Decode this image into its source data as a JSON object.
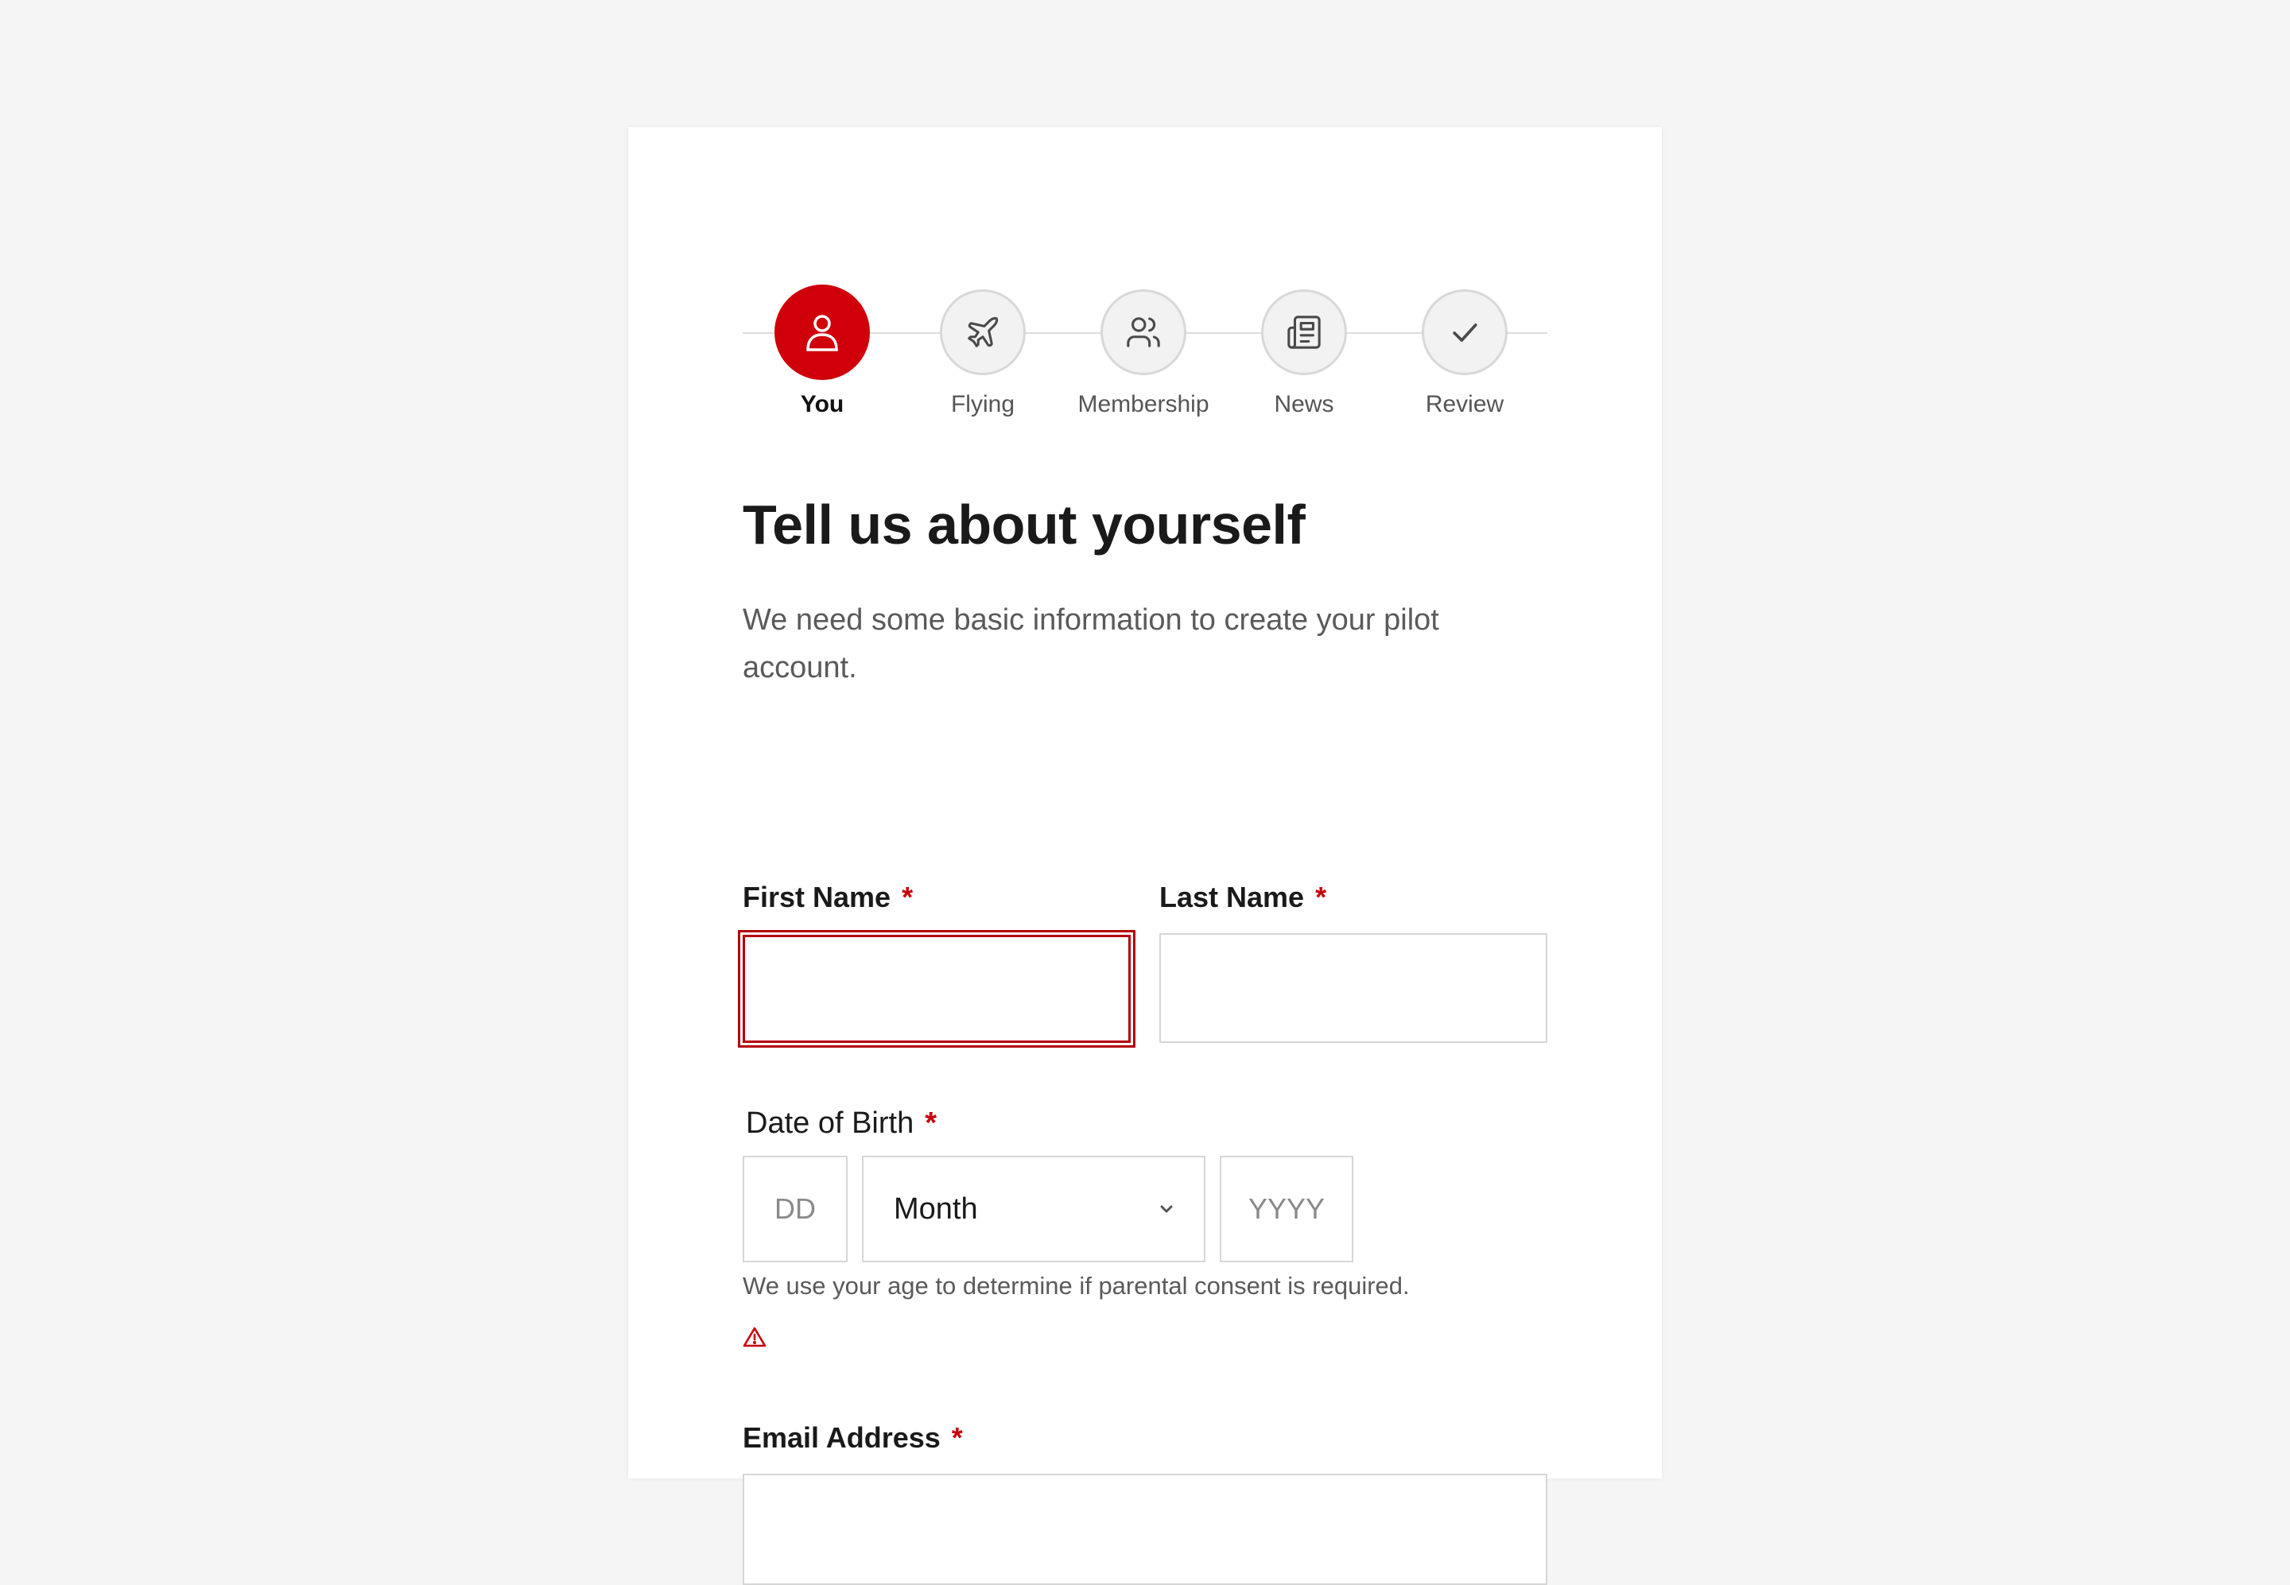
{
  "stepper": {
    "steps": [
      {
        "label": "You",
        "icon": "user-icon",
        "active": true
      },
      {
        "label": "Flying",
        "icon": "plane-icon",
        "active": false
      },
      {
        "label": "Membership",
        "icon": "users-icon",
        "active": false
      },
      {
        "label": "News",
        "icon": "newspaper-icon",
        "active": false
      },
      {
        "label": "Review",
        "icon": "check-icon",
        "active": false
      }
    ]
  },
  "form": {
    "title": "Tell us about yourself",
    "subtitle": "We need some basic information to create your pilot account.",
    "first_name": {
      "label": "First Name",
      "required_mark": "*",
      "value": ""
    },
    "last_name": {
      "label": "Last Name",
      "required_mark": "*",
      "value": ""
    },
    "dob": {
      "label": "Date of Birth",
      "required_mark": "*",
      "day_placeholder": "DD",
      "month_value": "Month",
      "year_placeholder": "YYYY",
      "hint": "We use your age to determine if parental consent is required."
    },
    "email": {
      "label": "Email Address",
      "required_mark": "*",
      "value": ""
    }
  },
  "colors": {
    "accent": "#d0000b",
    "error": "#b3000a",
    "background": "#f5f5f5"
  }
}
